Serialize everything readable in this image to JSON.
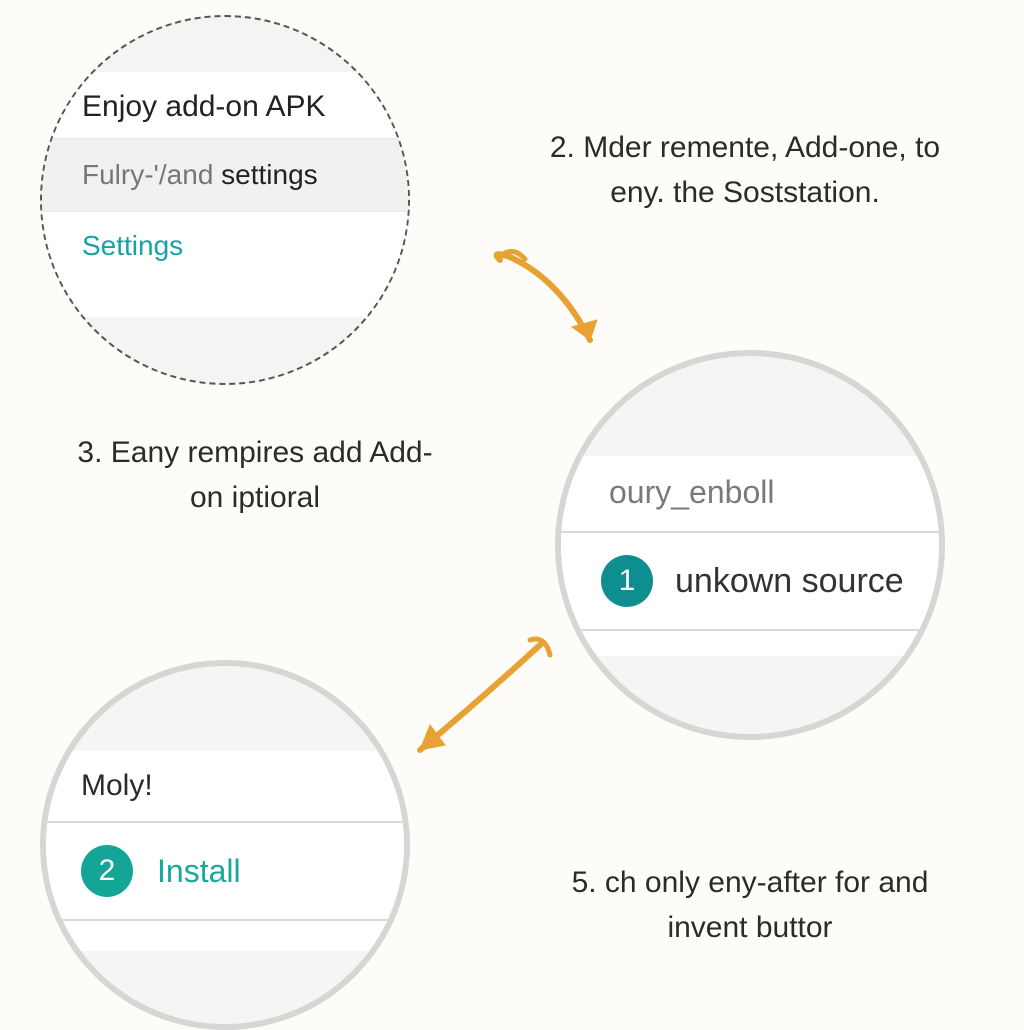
{
  "bubble1": {
    "title": "Enjoy add-on APK",
    "row2_a": "Fulry-'/and ",
    "row2_b": "settings",
    "settings": "Settings"
  },
  "bubble2": {
    "row_a": "oury_enboll",
    "badge": "1",
    "row_b": "unkown  source"
  },
  "bubble3": {
    "row_a": "Moly!",
    "badge": "2",
    "row_b": "Install"
  },
  "captions": {
    "c2": "2. Mder remente, Add-one, to eny. the Soststation.",
    "c3": "3. Eany rempires add Add-on iptioral",
    "c5": "5. ch only eny-after for and invent buttor"
  },
  "colors": {
    "accent_teal": "#0e8e8e",
    "accent_teal_light": "#13a596",
    "link_teal": "#17a2a8",
    "arrow": "#e7a233"
  }
}
